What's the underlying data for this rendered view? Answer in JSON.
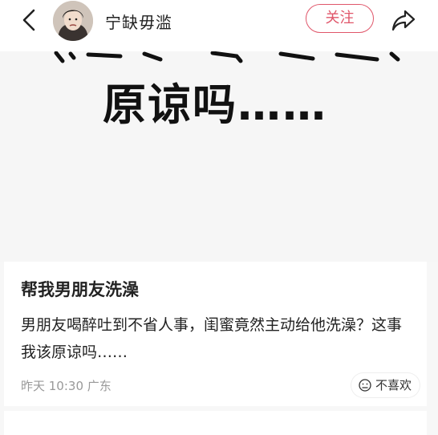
{
  "header": {
    "username": "宁缺毋滥",
    "follow_label": "关注"
  },
  "image": {
    "text": "原谅吗……"
  },
  "post": {
    "title": "帮我男朋友洗澡",
    "body": "男朋友喝醉吐到不省人事，闺蜜竟然主动给他洗澡？这事我该原谅吗……",
    "time": "昨天 10:30",
    "location": "广东",
    "dislike_label": "不喜欢"
  },
  "colors": {
    "accent": "#e0566a",
    "meta_gray": "#999999"
  },
  "icons": [
    "back-arrow-icon",
    "share-icon",
    "sad-face-icon"
  ]
}
